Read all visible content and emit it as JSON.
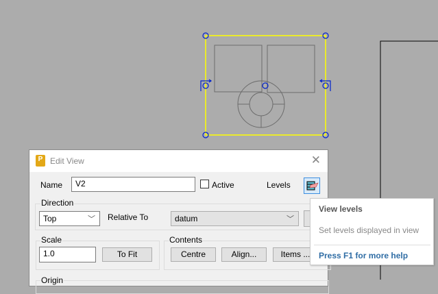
{
  "dialog": {
    "title": "Edit View",
    "close": "✕",
    "name_label": "Name",
    "name_value": "V2",
    "active_label": "Active",
    "levels_label": "Levels",
    "direction_label": "Direction",
    "direction_value": "Top",
    "relative_to_label": "Relative To",
    "relative_to_value": "datum",
    "scale_label": "Scale",
    "scale_value": "1.0",
    "to_fit": "To Fit",
    "contents_label": "Contents",
    "centre": "Centre",
    "align": "Align...",
    "items": "Items ...",
    "origin_label": "Origin",
    "app_icon": "P"
  },
  "tooltip": {
    "title": "View levels",
    "description": "Set levels displayed in view",
    "help": "Press F1 for more help"
  },
  "colors": {
    "selection": "#ffff00",
    "handle": "#0022cc",
    "accent": "#2e6ca4"
  }
}
